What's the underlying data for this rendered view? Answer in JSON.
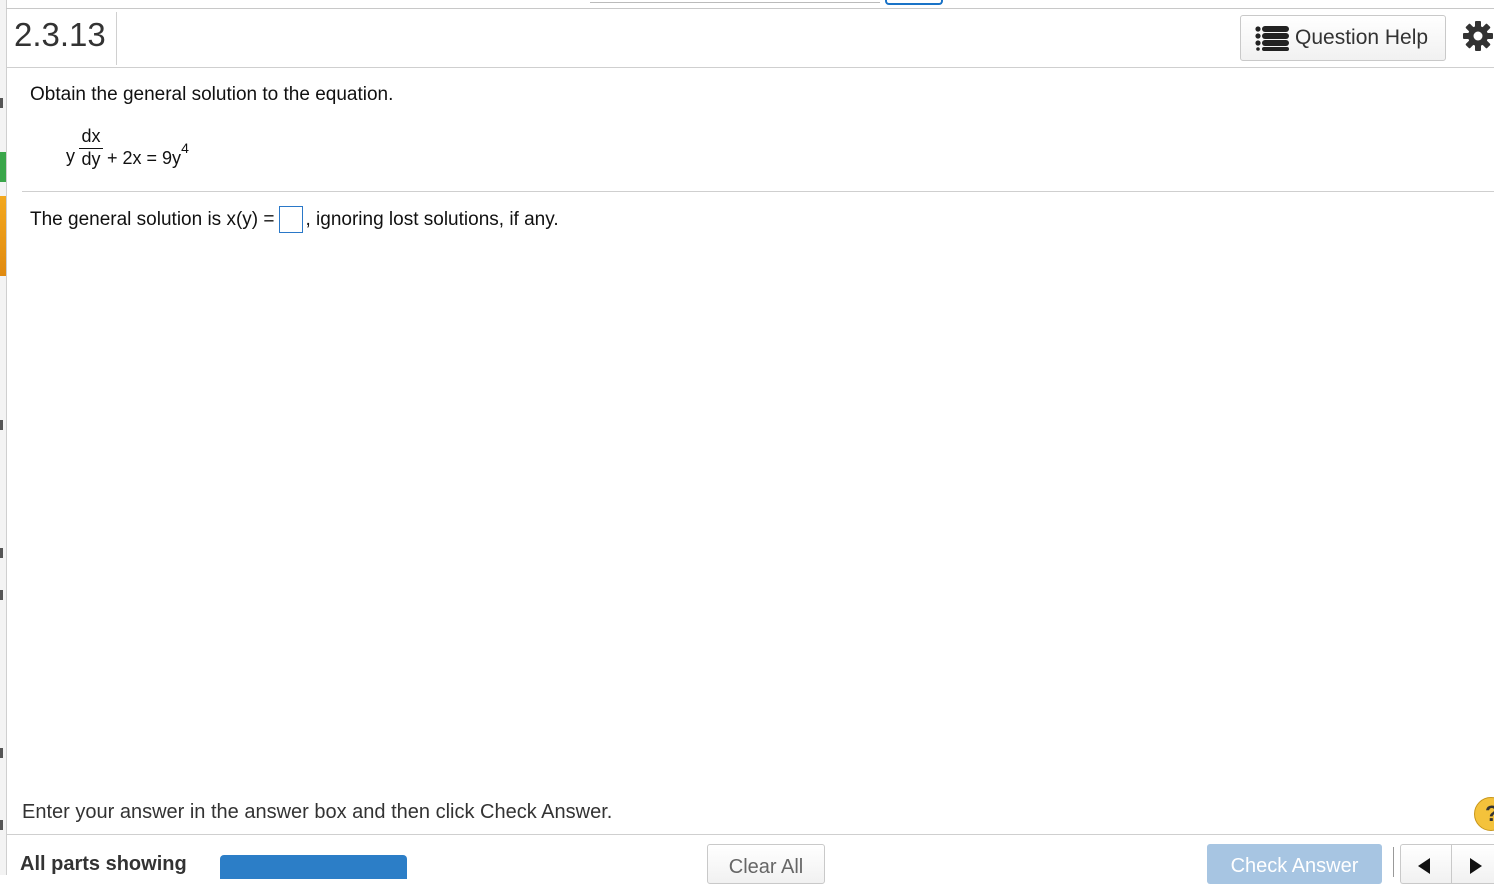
{
  "question": {
    "number": "2.3.13",
    "help_label": "Question Help",
    "prompt": "Obtain the general solution to the equation.",
    "equation": {
      "lhs_var": "y",
      "frac_num": "dx",
      "frac_den": "dy",
      "rest": "+ 2x = 9y",
      "exponent": "4"
    },
    "answer_prefix": "The general solution is x(y) =",
    "answer_value": "",
    "answer_suffix": ", ignoring lost solutions, if any."
  },
  "footer": {
    "instruction": "Enter your answer in the answer box and then click Check Answer.",
    "help_mark": "?",
    "parts_label": "All parts showing",
    "clear_label": "Clear All",
    "check_label": "Check Answer"
  },
  "icons": {
    "help": "list-icon",
    "settings": "gear-icon",
    "prev": "triangle-left-icon",
    "next": "triangle-right-icon"
  },
  "colors": {
    "accent_blue": "#2c7ec7",
    "check_button": "#a7c5e2",
    "help_mark": "#f4c23b"
  }
}
